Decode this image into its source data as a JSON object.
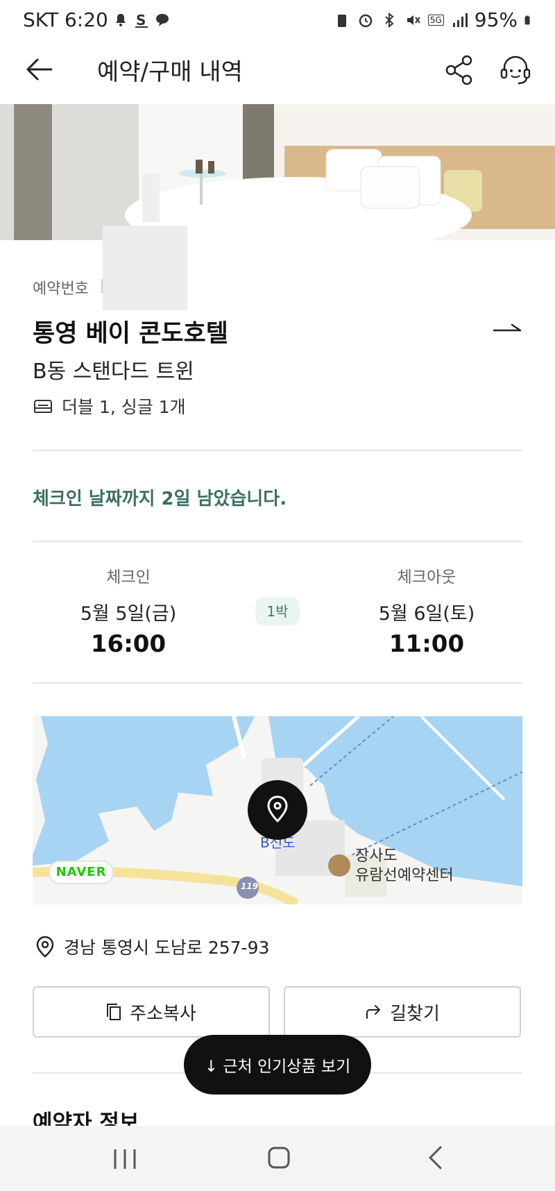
{
  "status_bar": {
    "carrier_time": "SKT 6:20",
    "network": "5G",
    "battery": "95%"
  },
  "header": {
    "title": "예약/구매 내역"
  },
  "booking": {
    "reservation_label": "예약번호",
    "hotel_name": "통영 베이 콘도호텔",
    "room_name": "B동 스탠다드 트윈",
    "beds": "더블 1, 싱글 1개",
    "countdown": "체크인 날짜까지 2일 남았습니다."
  },
  "stay": {
    "checkin_label": "체크인",
    "checkin_date": "5월 5일(금)",
    "checkin_time": "16:00",
    "nights": "1박",
    "checkout_label": "체크아웃",
    "checkout_date": "5월 6일(토)",
    "checkout_time": "11:00"
  },
  "map": {
    "provider_badge": "NAVER",
    "dock_label": "B선도",
    "poi_line1": "장사도",
    "poi_line2": "유람선예약센터",
    "road_number": "119",
    "water_color": "#a8d4f3",
    "land_color": "#f5f5f3"
  },
  "location": {
    "address": "경남 통영시 도남로 257-93",
    "copy_button": "주소복사",
    "route_button": "길찾기"
  },
  "floating_button": "↓ 근처 인기상품 보기",
  "next_section_title": "예약자 정보",
  "colors": {
    "accent_green": "#3d6e64",
    "nights_badge_bg": "#eaf4f1",
    "naver_green": "#1ec800"
  }
}
